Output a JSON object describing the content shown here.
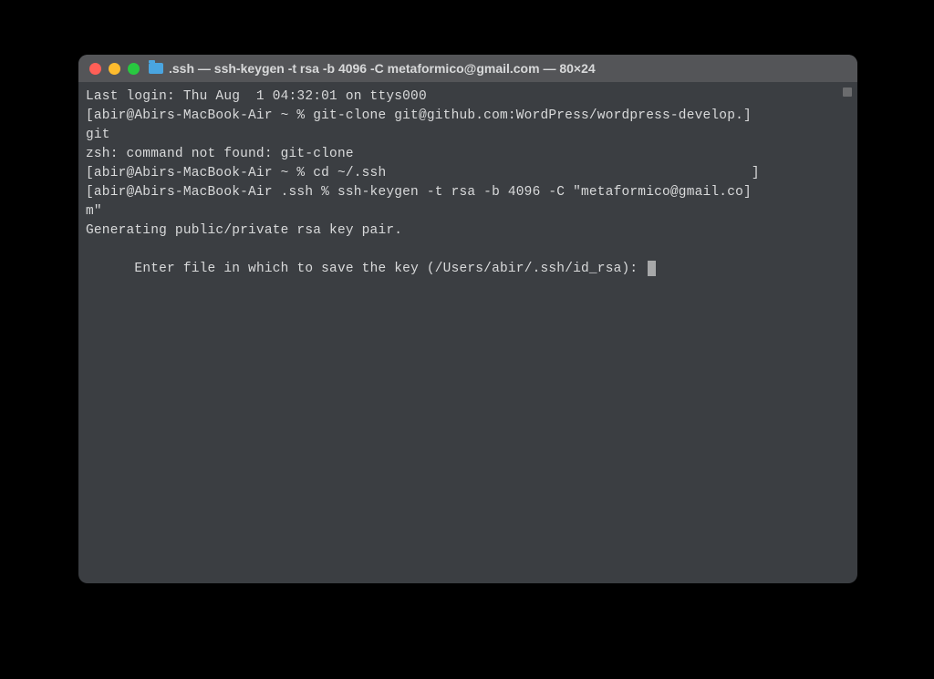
{
  "window": {
    "title": ".ssh — ssh-keygen -t rsa -b 4096 -C metaformico@gmail.com — 80×24"
  },
  "terminal": {
    "lines": {
      "l0": "Last login: Thu Aug  1 04:32:01 on ttys000",
      "l1": "[abir@Abirs-MacBook-Air ~ % git-clone git@github.com:WordPress/wordpress-develop.]",
      "l2": "git",
      "l3": "zsh: command not found: git-clone",
      "l4": "[abir@Abirs-MacBook-Air ~ % cd ~/.ssh                                             ]",
      "l5": "[abir@Abirs-MacBook-Air .ssh % ssh-keygen -t rsa -b 4096 -C \"metaformico@gmail.co]",
      "l6": "m\"",
      "l7": "Generating public/private rsa key pair.",
      "l8": "Enter file in which to save the key (/Users/abir/.ssh/id_rsa): "
    }
  }
}
